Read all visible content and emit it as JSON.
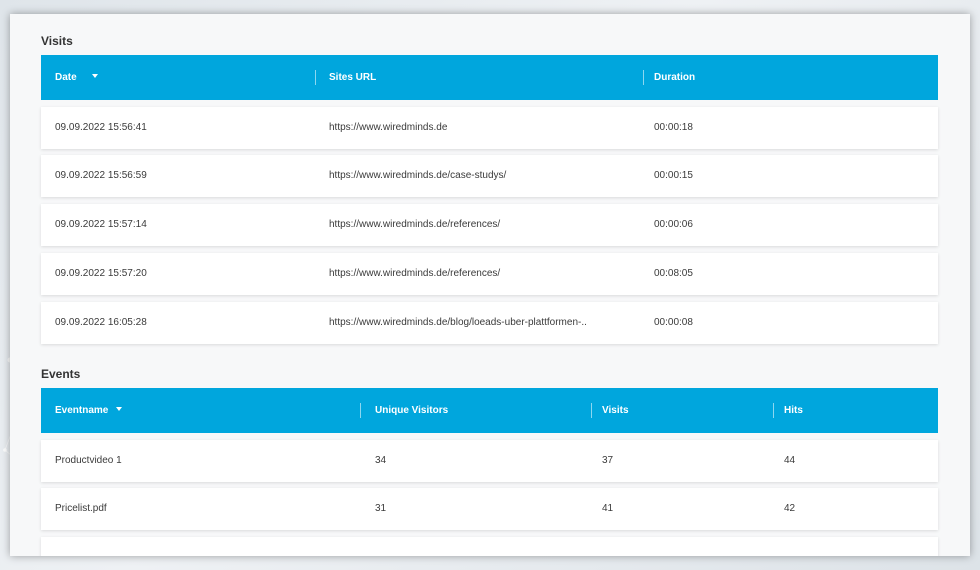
{
  "visits": {
    "title": "Visits",
    "columns": [
      "Date",
      "Sites URL",
      "Duration"
    ],
    "rows": [
      {
        "date": "09.09.2022 15:56:41",
        "url": "https://www.wiredminds.de",
        "duration": "00:00:18"
      },
      {
        "date": "09.09.2022 15:56:59",
        "url": "https://www.wiredminds.de/case-studys/",
        "duration": "00:00:15"
      },
      {
        "date": "09.09.2022 15:57:14",
        "url": "https://www.wiredminds.de/references/",
        "duration": "00:00:06"
      },
      {
        "date": "09.09.2022 15:57:20",
        "url": "https://www.wiredminds.de/references/",
        "duration": "00:08:05"
      },
      {
        "date": "09.09.2022 16:05:28",
        "url": "https://www.wiredminds.de/blog/loeads-uber-plattformen-..",
        "duration": "00:00:08"
      }
    ]
  },
  "events": {
    "title": "Events",
    "columns": [
      "Eventname",
      "Unique Visitors",
      "Visits",
      "Hits"
    ],
    "rows": [
      {
        "name": "Productvideo 1",
        "unique": "34",
        "visits": "37",
        "hits": "44"
      },
      {
        "name": "Pricelist.pdf",
        "unique": "31",
        "visits": "41",
        "hits": "42"
      }
    ]
  },
  "colors": {
    "header": "#00a6dd",
    "panel": "#f7f8f9",
    "row": "#ffffff"
  },
  "icons": [
    "sort-descending-icon"
  ]
}
